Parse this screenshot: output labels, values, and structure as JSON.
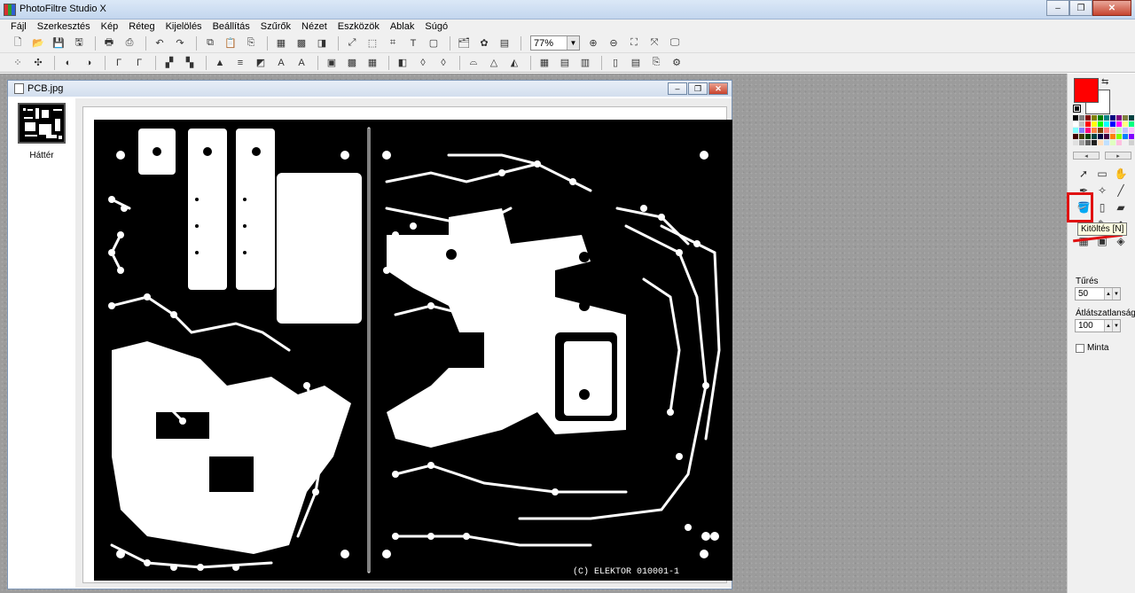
{
  "app": {
    "title": "PhotoFiltre Studio X"
  },
  "window_buttons": [
    "–",
    "❐",
    "✕"
  ],
  "menu": [
    "Fájl",
    "Szerkesztés",
    "Kép",
    "Réteg",
    "Kijelölés",
    "Beállítás",
    "Szűrők",
    "Nézet",
    "Eszközök",
    "Ablak",
    "Súgó"
  ],
  "toolbar": {
    "zoom_value": "77%"
  },
  "document": {
    "title": "PCB.jpg",
    "buttons": [
      "–",
      "❐",
      "✕"
    ],
    "layer_name": "Háttér",
    "silkscreen_text": "(C) ELEKTOR   010001-1"
  },
  "colors": {
    "primary": "#ff0000",
    "secondary": "#ffffff",
    "highlight": "#e01010"
  },
  "palette": [
    "#000000",
    "#808080",
    "#800000",
    "#808000",
    "#008000",
    "#008080",
    "#000080",
    "#800080",
    "#808040",
    "#004040",
    "#ffffff",
    "#c0c0c0",
    "#ff0000",
    "#ffff00",
    "#00ff00",
    "#00ffff",
    "#0000ff",
    "#ff00ff",
    "#ffff80",
    "#00ff80",
    "#80ffff",
    "#8080ff",
    "#ff0080",
    "#ff8040",
    "#804000",
    "#ff8080",
    "#ffc0c0",
    "#c0ffc0",
    "#c0c0ff",
    "#ffc0ff",
    "#400000",
    "#404000",
    "#004000",
    "#004040",
    "#000040",
    "#400040",
    "#ff8000",
    "#80ff00",
    "#0080ff",
    "#8000ff",
    "#e0e0e0",
    "#a0a0a0",
    "#606060",
    "#202020",
    "#ffe0c0",
    "#c0e0ff",
    "#e0ffc0",
    "#ffc0e0",
    "#f0f0f0",
    "#d0d0d0"
  ],
  "palette_nav": [
    "◂",
    "▸"
  ],
  "tools": [
    "selection-arrow-icon",
    "selection-rect-icon",
    "hand-icon",
    "pipette-icon",
    "magic-wand-icon",
    "line-icon",
    "fill-bucket-icon",
    "spray-icon",
    "eraser-icon",
    "brush-icon",
    "stamp-icon",
    "smudge-icon",
    "grid-icon",
    "portrait-icon",
    "strawberry-icon"
  ],
  "tool_glyphs": [
    "➚",
    "▭",
    "✋",
    "✒",
    "✧",
    "╱",
    "🪣",
    "▯",
    "▰",
    "♨",
    "✎",
    "◆",
    "▦",
    "▣",
    "◈"
  ],
  "tooltip": "Kitöltés [N]",
  "panel": {
    "tolerance_label": "Tűrés",
    "tolerance_value": "50",
    "opacity_label": "Átlátszatlanság",
    "opacity_value": "100",
    "pattern_label": "Minta"
  }
}
